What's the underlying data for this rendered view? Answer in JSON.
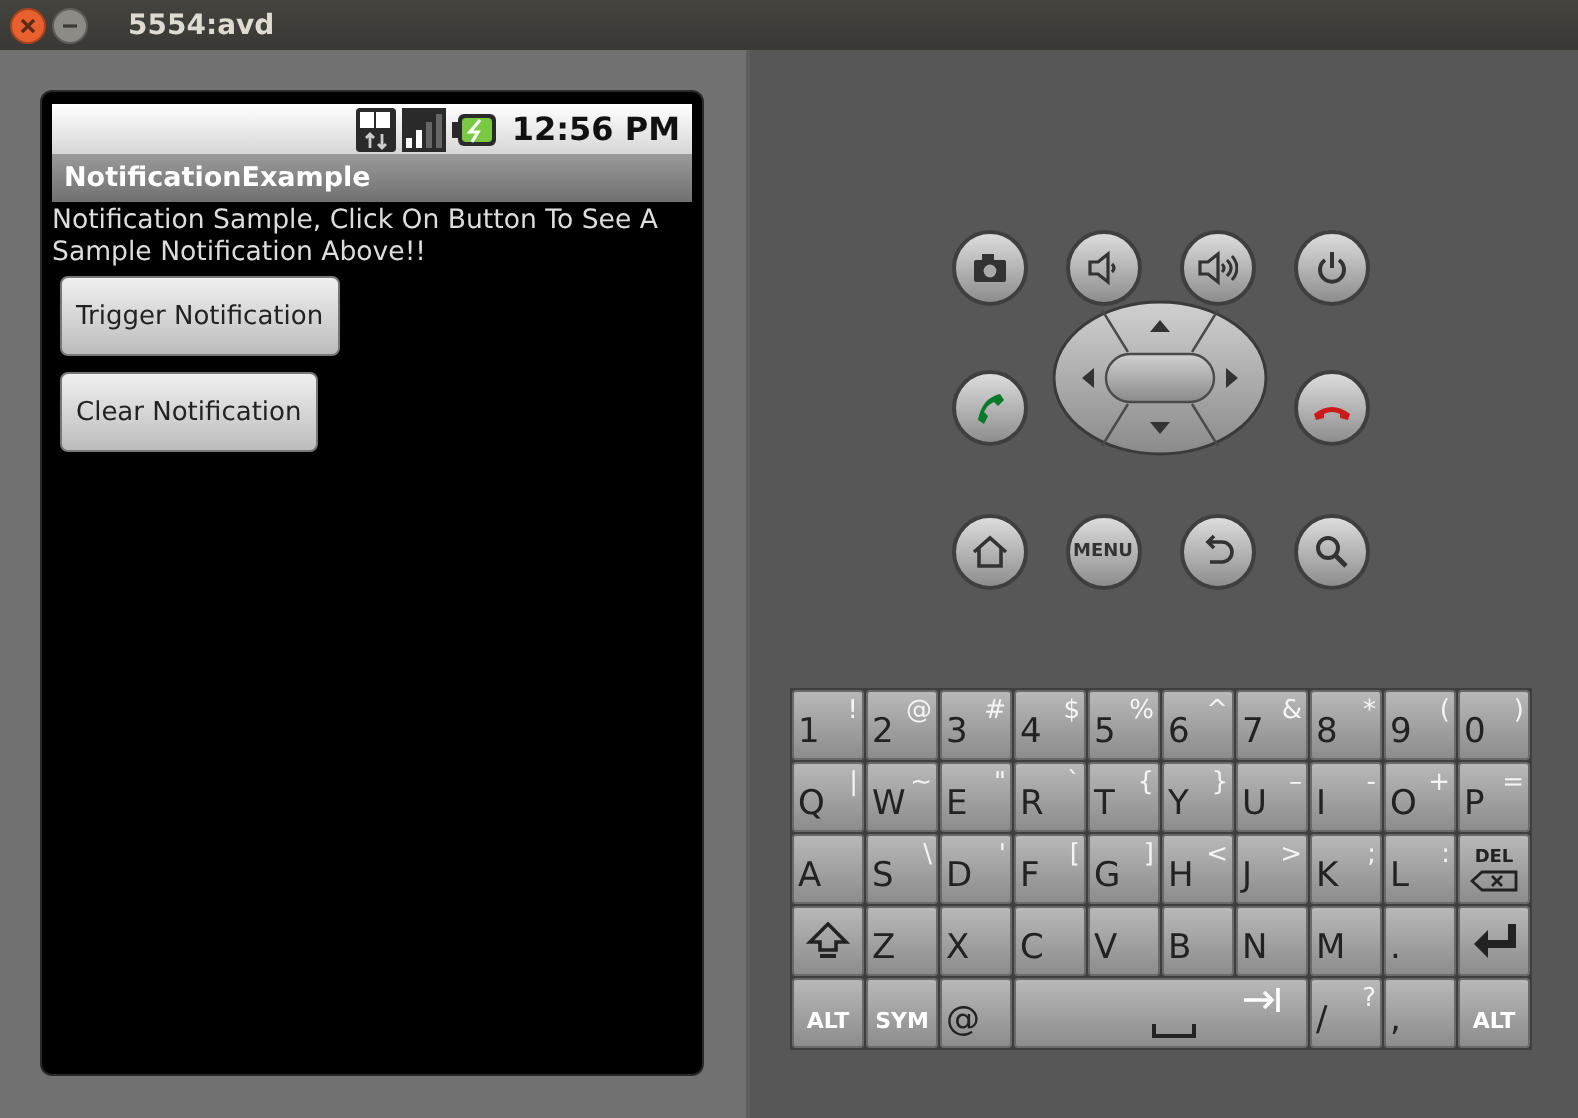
{
  "window": {
    "title": "5554:avd"
  },
  "phone": {
    "status_bar": {
      "time": "12:56 PM"
    },
    "app_title": "NotificationExample",
    "message": "Notification Sample, Click On Button To See A Sample Notification Above!!",
    "buttons": [
      {
        "label": "Trigger Notification"
      },
      {
        "label": "Clear Notification"
      }
    ]
  },
  "hardware_buttons": [
    {
      "kind": "camera"
    },
    {
      "kind": "volume-down"
    },
    {
      "kind": "volume-up"
    },
    {
      "kind": "power"
    },
    {
      "kind": "call"
    },
    {
      "kind": "dpad"
    },
    {
      "kind": "hangup"
    },
    {
      "kind": "home"
    },
    {
      "kind": "menu",
      "label": "MENU"
    },
    {
      "kind": "back"
    },
    {
      "kind": "search"
    }
  ],
  "keyboard": {
    "rows": [
      [
        {
          "kind": "char",
          "label": "1",
          "alt": "!"
        },
        {
          "kind": "char",
          "label": "2",
          "alt": "@"
        },
        {
          "kind": "char",
          "label": "3",
          "alt": "#"
        },
        {
          "kind": "char",
          "label": "4",
          "alt": "$"
        },
        {
          "kind": "char",
          "label": "5",
          "alt": "%"
        },
        {
          "kind": "char",
          "label": "6",
          "alt": "^"
        },
        {
          "kind": "char",
          "label": "7",
          "alt": "&"
        },
        {
          "kind": "char",
          "label": "8",
          "alt": "*"
        },
        {
          "kind": "char",
          "label": "9",
          "alt": "("
        },
        {
          "kind": "char",
          "label": "0",
          "alt": ")"
        }
      ],
      [
        {
          "kind": "char",
          "label": "Q",
          "alt": "|"
        },
        {
          "kind": "char",
          "label": "W",
          "alt": "~"
        },
        {
          "kind": "char",
          "label": "E",
          "alt": "\""
        },
        {
          "kind": "char",
          "label": "R",
          "alt": "`"
        },
        {
          "kind": "char",
          "label": "T",
          "alt": "{"
        },
        {
          "kind": "char",
          "label": "Y",
          "alt": "}"
        },
        {
          "kind": "char",
          "label": "U",
          "alt": "–"
        },
        {
          "kind": "char",
          "label": "I",
          "alt": "-"
        },
        {
          "kind": "char",
          "label": "O",
          "alt": "+"
        },
        {
          "kind": "char",
          "label": "P",
          "alt": "="
        }
      ],
      [
        {
          "kind": "char",
          "label": "A"
        },
        {
          "kind": "char",
          "label": "S",
          "alt": "\\"
        },
        {
          "kind": "char",
          "label": "D",
          "alt": "'"
        },
        {
          "kind": "char",
          "label": "F",
          "alt": "["
        },
        {
          "kind": "char",
          "label": "G",
          "alt": "]"
        },
        {
          "kind": "char",
          "label": "H",
          "alt": "<"
        },
        {
          "kind": "char",
          "label": "J",
          "alt": ">"
        },
        {
          "kind": "char",
          "label": "K",
          "alt": ";"
        },
        {
          "kind": "char",
          "label": "L",
          "alt": ":"
        },
        {
          "kind": "del",
          "label": "DEL"
        }
      ],
      [
        {
          "kind": "shift"
        },
        {
          "kind": "char",
          "label": "Z"
        },
        {
          "kind": "char",
          "label": "X"
        },
        {
          "kind": "char",
          "label": "C"
        },
        {
          "kind": "char",
          "label": "V"
        },
        {
          "kind": "char",
          "label": "B"
        },
        {
          "kind": "char",
          "label": "N"
        },
        {
          "kind": "char",
          "label": "M"
        },
        {
          "kind": "char",
          "label": "."
        },
        {
          "kind": "enter"
        }
      ],
      [
        {
          "kind": "small",
          "label": "ALT"
        },
        {
          "kind": "small",
          "label": "SYM"
        },
        {
          "kind": "char",
          "label": "@"
        },
        {
          "kind": "space"
        },
        "",
        "",
        "",
        {
          "kind": "char",
          "label": "/",
          "alt": "?"
        },
        {
          "kind": "char",
          "label": ","
        },
        {
          "kind": "small",
          "label": "ALT"
        }
      ]
    ]
  }
}
